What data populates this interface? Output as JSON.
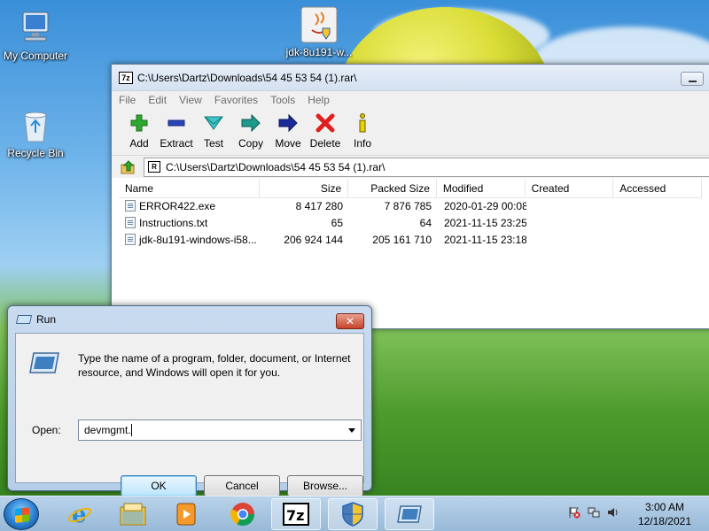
{
  "desktop": {
    "icons": [
      {
        "label": "My Computer"
      },
      {
        "label": "Recycle Bin"
      },
      {
        "label": "jdk-8u191-w..."
      }
    ]
  },
  "sevenzip": {
    "title": "C:\\Users\\Dartz\\Downloads\\54 45 53 54  (1).rar\\",
    "menu": [
      "File",
      "Edit",
      "View",
      "Favorites",
      "Tools",
      "Help"
    ],
    "toolbar": [
      "Add",
      "Extract",
      "Test",
      "Copy",
      "Move",
      "Delete",
      "Info"
    ],
    "address": "C:\\Users\\Dartz\\Downloads\\54 45 53 54  (1).rar\\",
    "columns": [
      "Name",
      "Size",
      "Packed Size",
      "Modified",
      "Created",
      "Accessed"
    ],
    "rows": [
      {
        "name": "ERROR422.exe",
        "size": "8 417 280",
        "packed": "7 876 785",
        "modified": "2020-01-29 00:08"
      },
      {
        "name": "Instructions.txt",
        "size": "65",
        "packed": "64",
        "modified": "2021-11-15 23:25"
      },
      {
        "name": "jdk-8u191-windows-i58...",
        "size": "206 924 144",
        "packed": "205 161 710",
        "modified": "2021-11-15 23:18"
      }
    ]
  },
  "run": {
    "title": "Run",
    "description": "Type the name of a program, folder, document, or Internet resource, and Windows will open it for you.",
    "open_label": "Open:",
    "open_value": "devmgmt.",
    "ok": "OK",
    "cancel": "Cancel",
    "browse": "Browse..."
  },
  "taskbar": {
    "time": "3:00 AM",
    "date": "12/18/2021"
  },
  "colors": {
    "accent": "#3c7fb1",
    "add_green": "#2fa82f",
    "delete_red": "#e02020",
    "taskbar": "#a8c6e2"
  }
}
